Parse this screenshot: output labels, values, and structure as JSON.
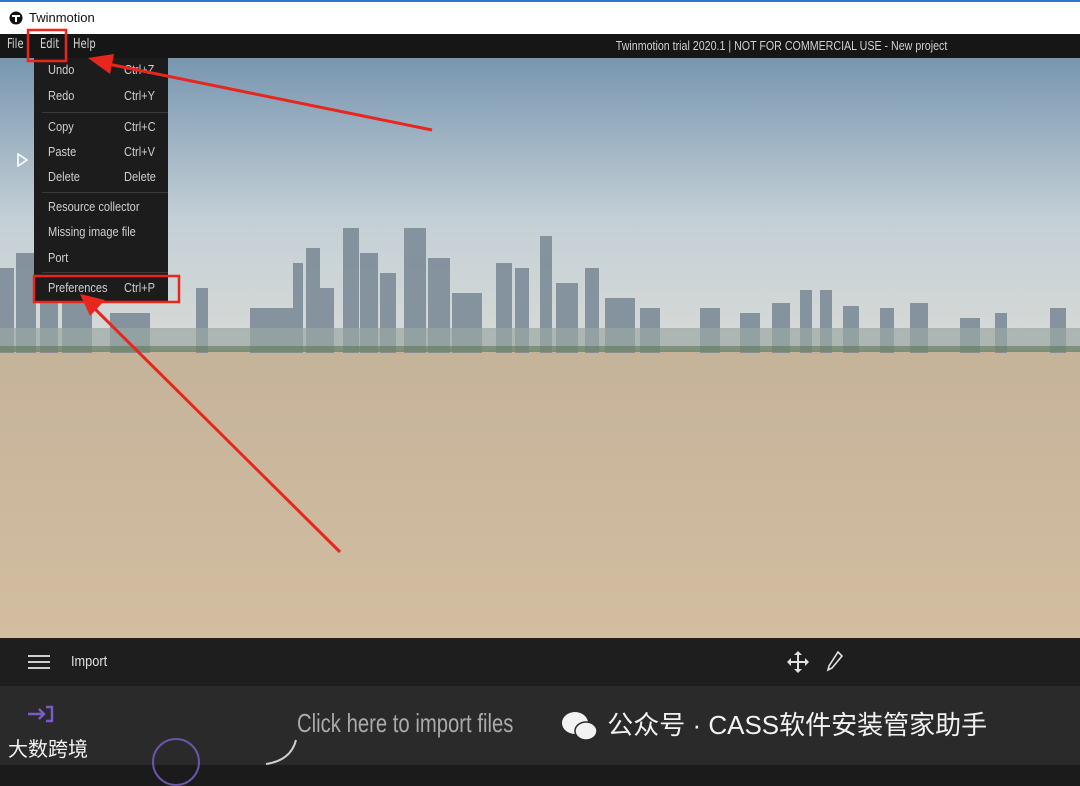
{
  "window": {
    "title": "Twinmotion"
  },
  "menubar": {
    "items": [
      "File",
      "Edit",
      "Help"
    ],
    "status": "Twinmotion trial 2020.1 | NOT FOR COMMERCIAL USE - New project"
  },
  "edit_menu": {
    "items": [
      {
        "label": "Undo",
        "shortcut": "Ctrl+Z"
      },
      {
        "label": "Redo",
        "shortcut": "Ctrl+Y"
      },
      {
        "label": "Copy",
        "shortcut": "Ctrl+C"
      },
      {
        "label": "Paste",
        "shortcut": "Ctrl+V"
      },
      {
        "label": "Delete",
        "shortcut": "Delete"
      },
      {
        "label": "Resource collector",
        "shortcut": ""
      },
      {
        "label": "Missing image file",
        "shortcut": ""
      },
      {
        "label": "Port",
        "shortcut": ""
      },
      {
        "label": "Preferences",
        "shortcut": "Ctrl+P"
      }
    ]
  },
  "bottom_panel": {
    "title": "Import",
    "hint": "Click here to import files"
  },
  "watermarks": {
    "right": "公众号 · CASS软件安装管家助手",
    "left": "大数跨境"
  },
  "colors": {
    "annotation": "#e8261d",
    "accent": "#6b55a8"
  }
}
